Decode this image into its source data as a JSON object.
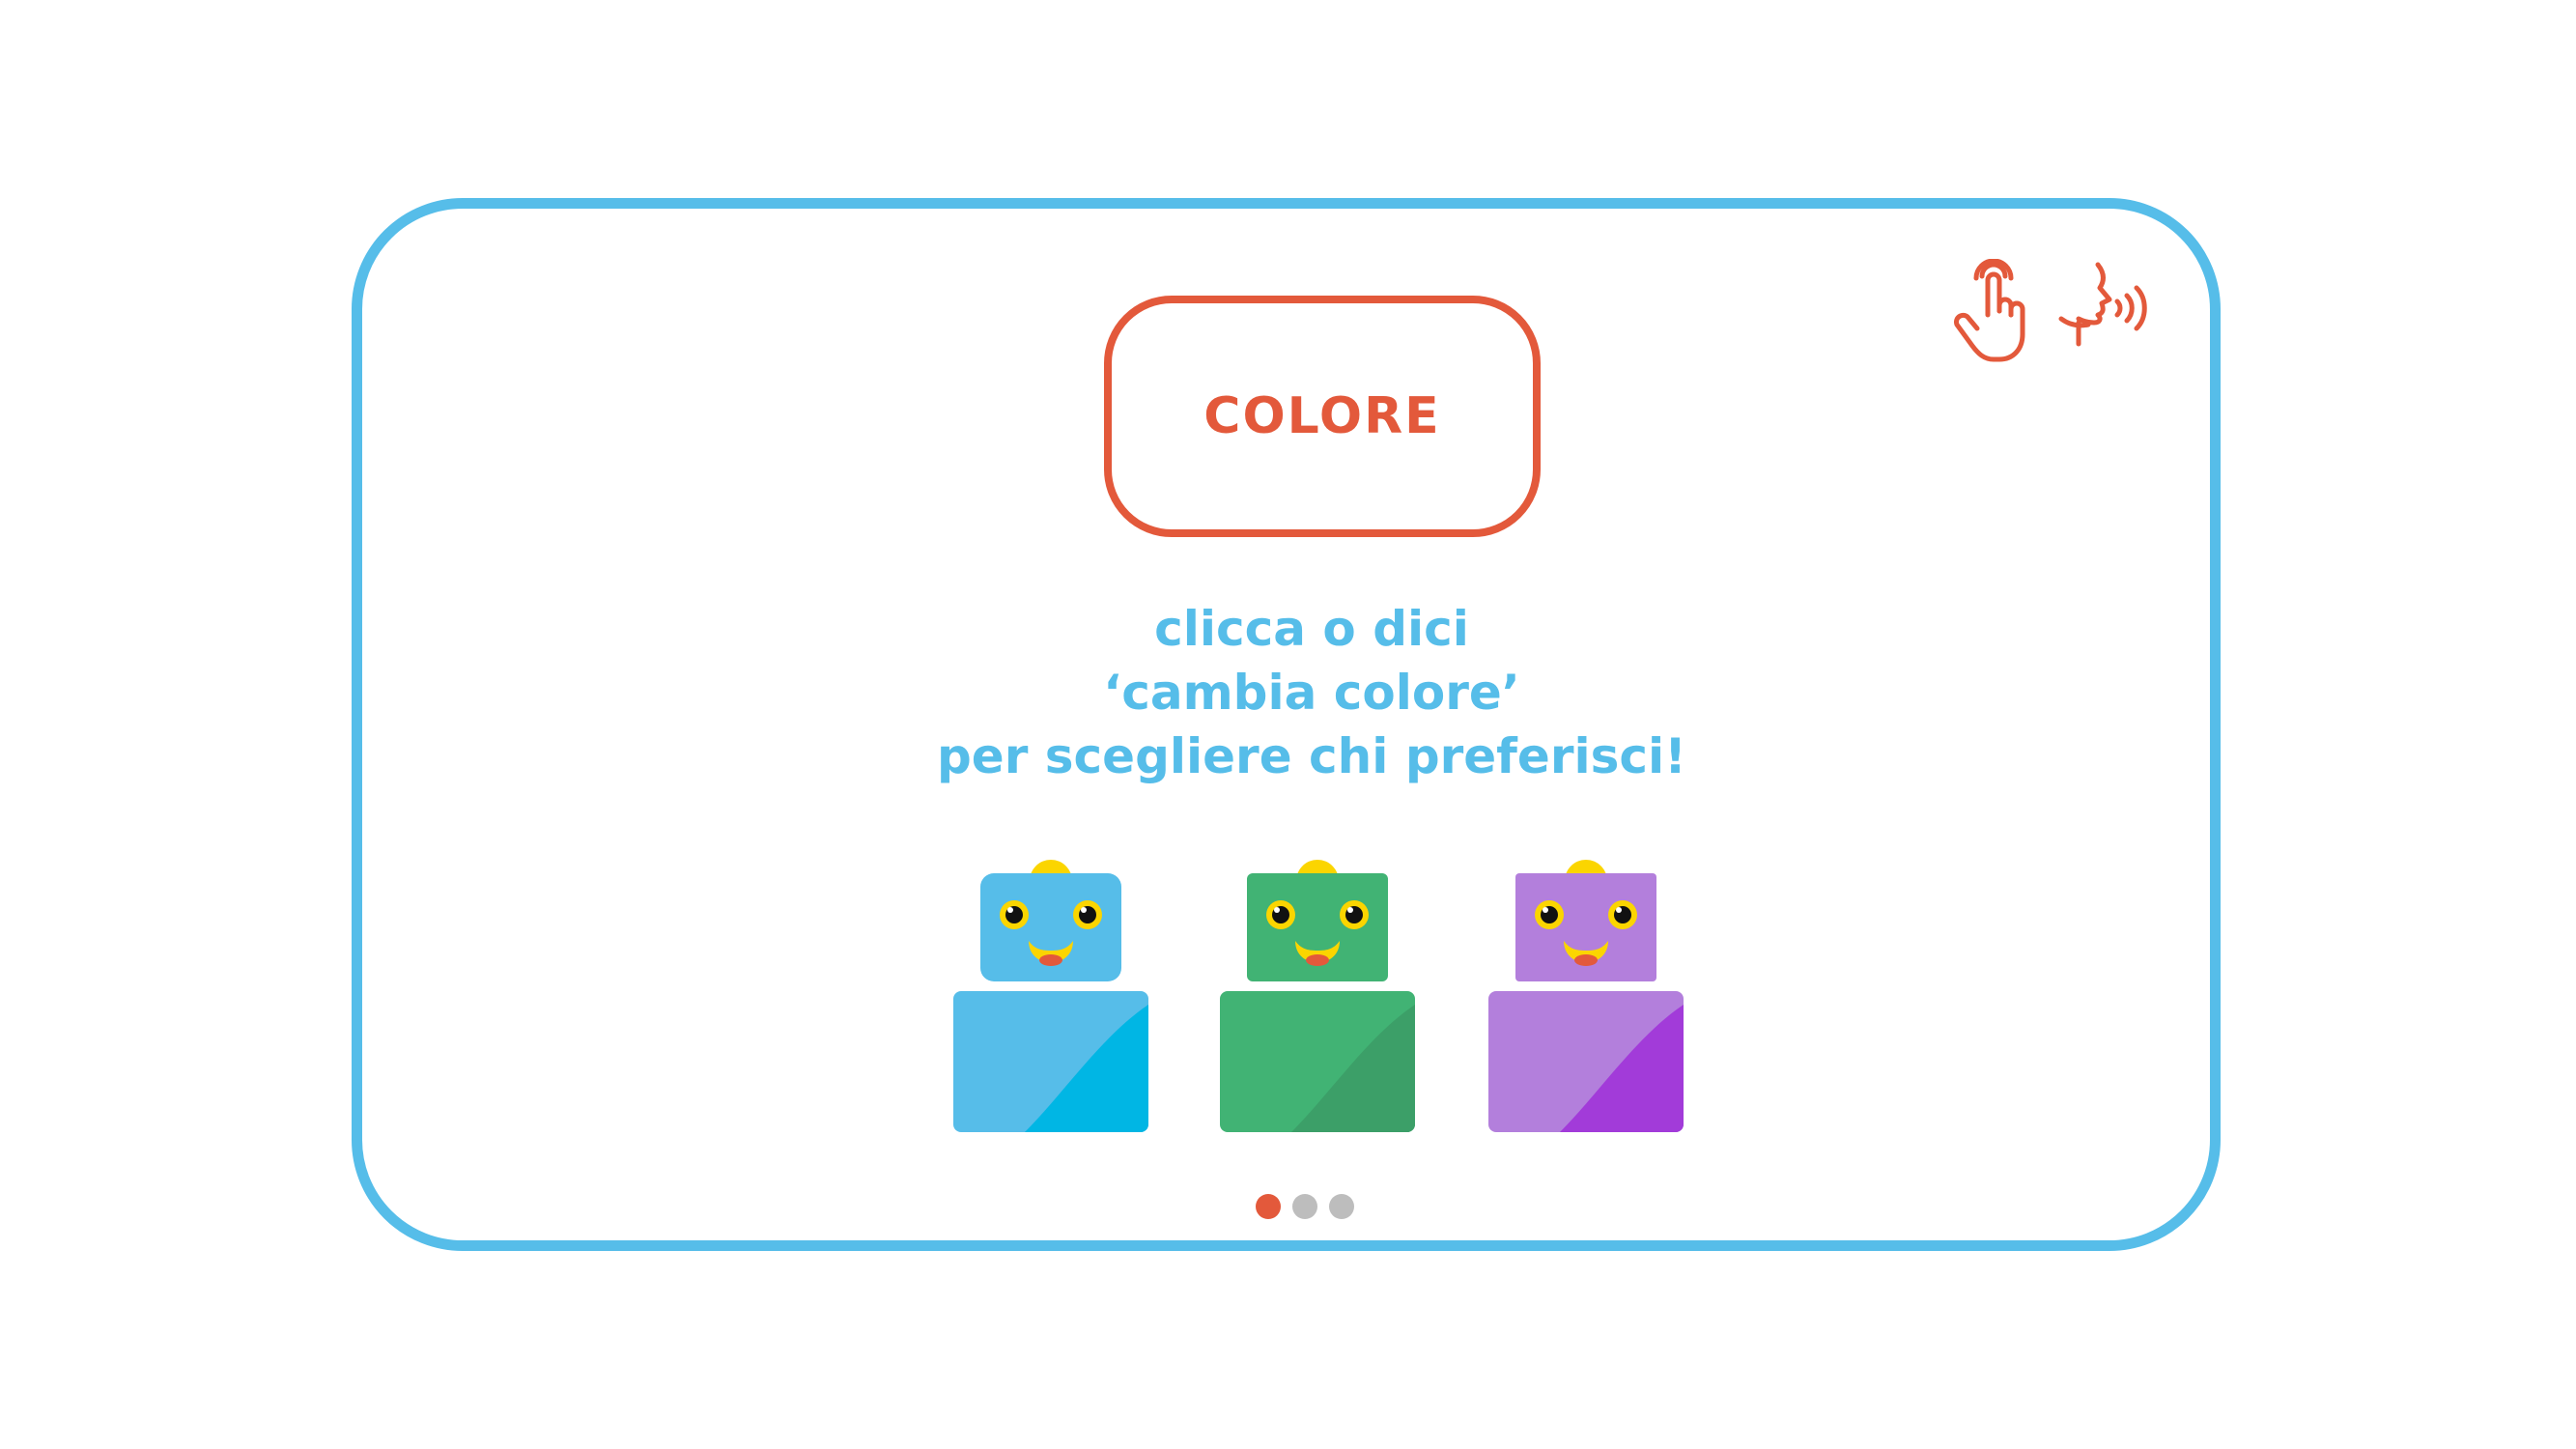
{
  "card": {
    "title": "COLORE",
    "instruction_lines": [
      "clicca o dici",
      "‘cambia colore’",
      "per scegliere chi preferisci!"
    ]
  },
  "mode_icons": [
    {
      "name": "touch-hand-icon"
    },
    {
      "name": "voice-speaking-icon"
    }
  ],
  "robots": [
    {
      "color_name": "blue",
      "body": "#56bde9",
      "body_shade": "#00b6e4",
      "head": "#56bde9"
    },
    {
      "color_name": "green",
      "body": "#41b374",
      "body_shade": "#3c9f68",
      "head": "#41b374"
    },
    {
      "color_name": "purple",
      "body": "#b37fdc",
      "body_shade": "#a23bd9",
      "head": "#b37fdc"
    }
  ],
  "pagination": {
    "total": 3,
    "active_index": 0
  },
  "colors": {
    "frame": "#56bde9",
    "accent": "#e3593b",
    "text": "#56bde9",
    "dot_inactive": "#bdbdbd",
    "antenna": "#fbd500",
    "mouth": "#fbd500",
    "tongue": "#e3593b"
  }
}
